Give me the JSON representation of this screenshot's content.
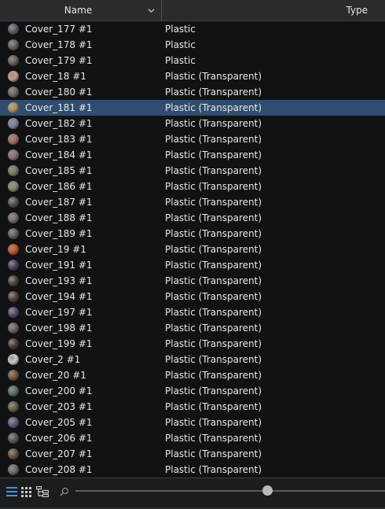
{
  "header": {
    "name_label": "Name",
    "type_label": "Type"
  },
  "rows": [
    {
      "name": "Cover_177 #1",
      "type": "Plastic",
      "color": "#5a5d66"
    },
    {
      "name": "Cover_178 #1",
      "type": "Plastic",
      "color": "#62645f"
    },
    {
      "name": "Cover_179 #1",
      "type": "Plastic",
      "color": "#6a5f55"
    },
    {
      "name": "Cover_18 #1",
      "type": "Plastic (Transparent)",
      "color": "#c89a86"
    },
    {
      "name": "Cover_180 #1",
      "type": "Plastic (Transparent)",
      "color": "#6c6a5e"
    },
    {
      "name": "Cover_181 #1",
      "type": "Plastic (Transparent)",
      "color": "#b08a4e",
      "selected": true
    },
    {
      "name": "Cover_182 #1",
      "type": "Plastic (Transparent)",
      "color": "#7c83a2"
    },
    {
      "name": "Cover_183 #1",
      "type": "Plastic (Transparent)",
      "color": "#a06f62"
    },
    {
      "name": "Cover_184 #1",
      "type": "Plastic (Transparent)",
      "color": "#8c6c74"
    },
    {
      "name": "Cover_185 #1",
      "type": "Plastic (Transparent)",
      "color": "#7a7a62"
    },
    {
      "name": "Cover_186 #1",
      "type": "Plastic (Transparent)",
      "color": "#7e8a6e"
    },
    {
      "name": "Cover_187 #1",
      "type": "Plastic (Transparent)",
      "color": "#55504b"
    },
    {
      "name": "Cover_188 #1",
      "type": "Plastic (Transparent)",
      "color": "#7a6a6a"
    },
    {
      "name": "Cover_189 #1",
      "type": "Plastic (Transparent)",
      "color": "#626066"
    },
    {
      "name": "Cover_19 #1",
      "type": "Plastic (Transparent)",
      "color": "#c4561e"
    },
    {
      "name": "Cover_191 #1",
      "type": "Plastic (Transparent)",
      "color": "#4c3f5e"
    },
    {
      "name": "Cover_193 #1",
      "type": "Plastic (Transparent)",
      "color": "#4f4232"
    },
    {
      "name": "Cover_194 #1",
      "type": "Plastic (Transparent)",
      "color": "#5a3e36"
    },
    {
      "name": "Cover_197 #1",
      "type": "Plastic (Transparent)",
      "color": "#5a4a6e"
    },
    {
      "name": "Cover_198 #1",
      "type": "Plastic (Transparent)",
      "color": "#6e5d68"
    },
    {
      "name": "Cover_199 #1",
      "type": "Plastic (Transparent)",
      "color": "#4c3b34"
    },
    {
      "name": "Cover_2 #1",
      "type": "Plastic (Transparent)",
      "color": "#c9cbcf"
    },
    {
      "name": "Cover_20 #1",
      "type": "Plastic (Transparent)",
      "color": "#7a5538"
    },
    {
      "name": "Cover_200 #1",
      "type": "Plastic (Transparent)",
      "color": "#5e6a6c"
    },
    {
      "name": "Cover_203 #1",
      "type": "Plastic (Transparent)",
      "color": "#6a6048"
    },
    {
      "name": "Cover_205 #1",
      "type": "Plastic (Transparent)",
      "color": "#5e5e80"
    },
    {
      "name": "Cover_206 #1",
      "type": "Plastic (Transparent)",
      "color": "#5a5a5a"
    },
    {
      "name": "Cover_207 #1",
      "type": "Plastic (Transparent)",
      "color": "#6a5236"
    },
    {
      "name": "Cover_208 #1",
      "type": "Plastic (Transparent)",
      "color": "#6c6c6c"
    }
  ],
  "footer": {
    "icons": [
      "list-view-icon",
      "grid-view-icon",
      "tree-view-icon",
      "zoom-icon"
    ],
    "zoom_level": 0.62
  },
  "colors": {
    "accent": "#4a8fe0",
    "selection": "#2f4d6e"
  }
}
